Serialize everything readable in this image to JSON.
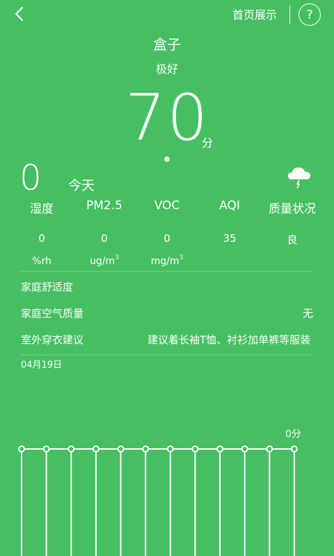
{
  "header": {
    "home_display_label": "首页展示",
    "help_label": "?"
  },
  "device": {
    "name": "盒子",
    "quality_word": "极好",
    "score": "70",
    "score_unit": "分"
  },
  "weather": {
    "temperature": "0",
    "day_label": "今天",
    "icon": "cloud-rain-icon"
  },
  "metrics": {
    "labels": [
      "湿度",
      "PM2.5",
      "VOC",
      "AQI",
      "质量状况"
    ],
    "values": [
      "0",
      "0",
      "0",
      "35",
      "良"
    ],
    "units": [
      "%rh",
      "ug/m",
      "mg/m"
    ],
    "unit_superscript": "3"
  },
  "rows": [
    {
      "label": "家庭舒适度",
      "value": ""
    },
    {
      "label": "家庭空气质量",
      "value": "无"
    },
    {
      "label": "室外穿衣建议",
      "value": "建议着长袖T恤、衬衫加单裤等服装"
    }
  ],
  "date": "04月19日",
  "chart_data": {
    "type": "line",
    "categories": [
      "",
      "",
      "",
      "",
      "",
      "",
      "",
      "",
      "",
      "",
      "",
      ""
    ],
    "values": [
      0,
      0,
      0,
      0,
      0,
      0,
      0,
      0,
      0,
      0,
      0,
      0
    ],
    "last_point_label": "0分",
    "grid": true
  },
  "colors": {
    "background": "#46bf62",
    "foreground": "#ffffff"
  }
}
